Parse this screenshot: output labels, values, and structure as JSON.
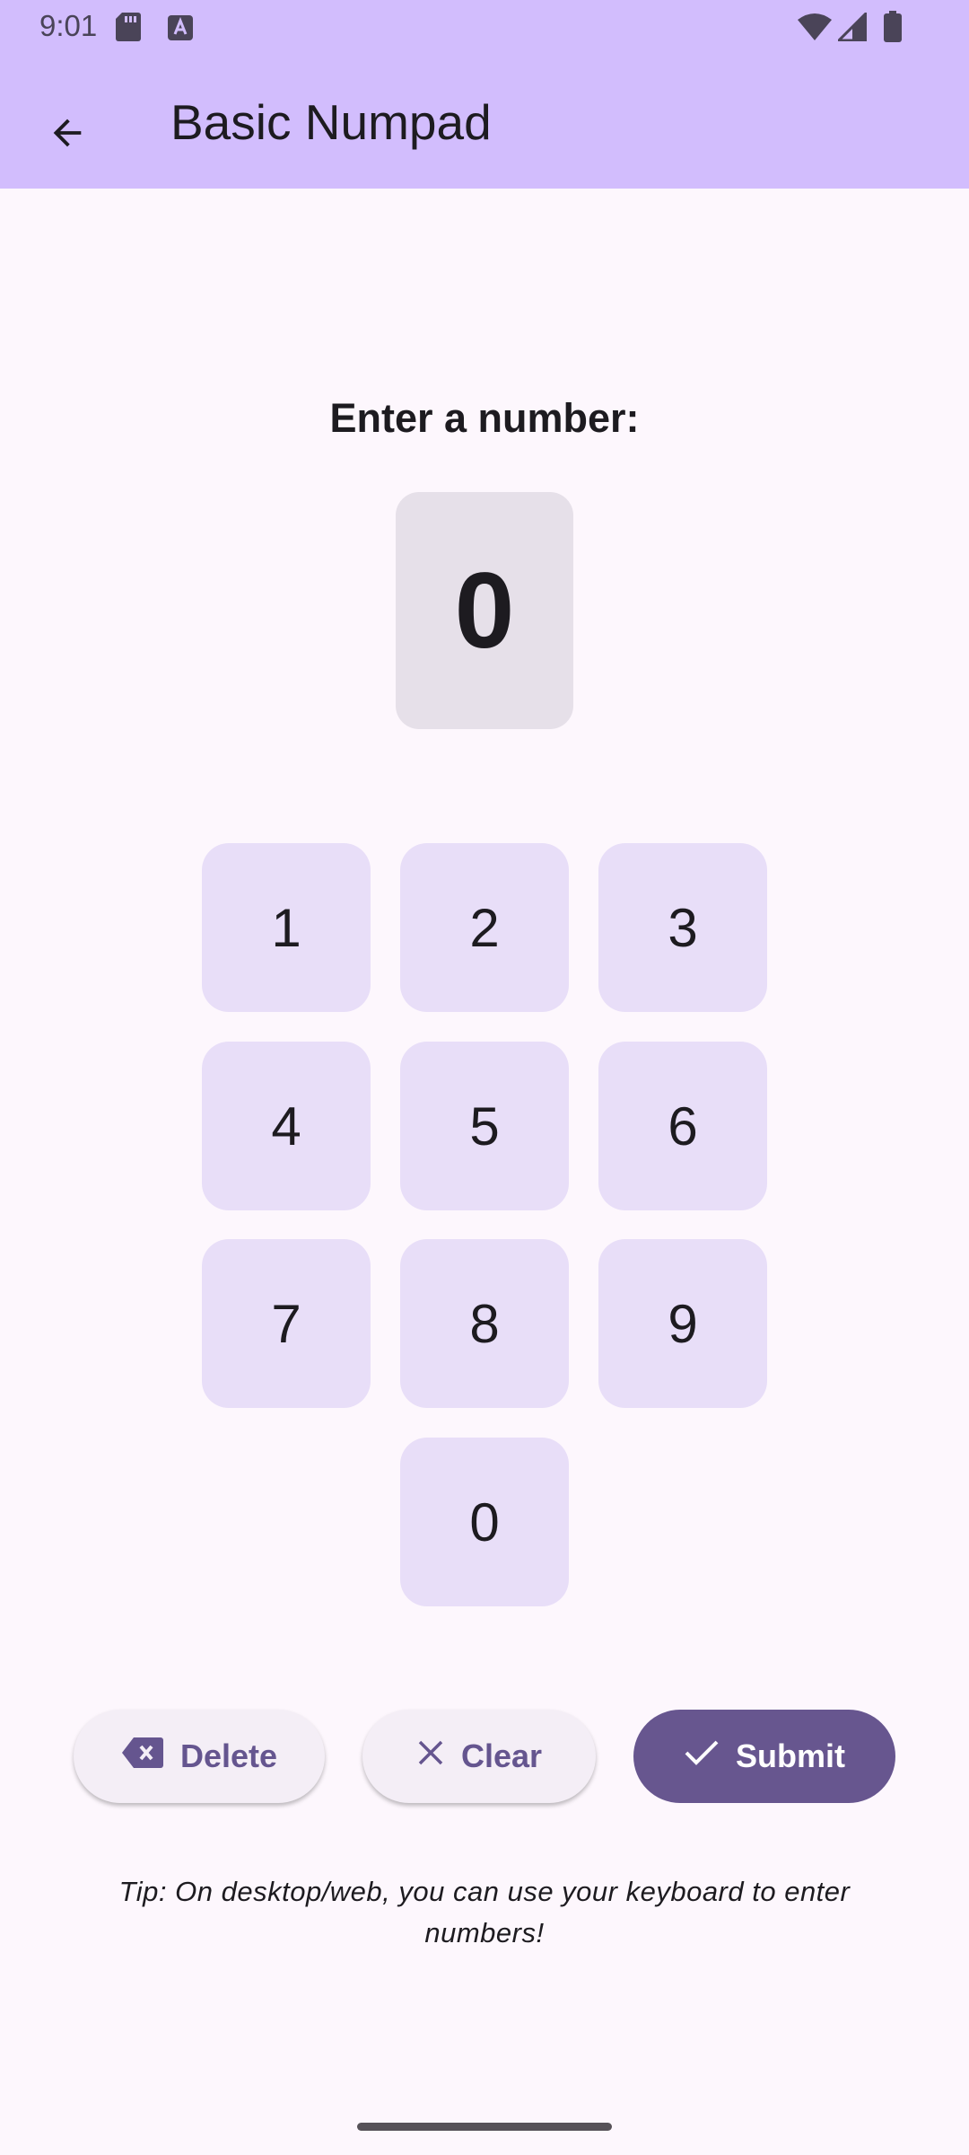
{
  "status_bar": {
    "time": "9:01",
    "icons": [
      "sd-card-icon",
      "keyboard-a-icon",
      "wifi-icon",
      "signal-icon",
      "battery-icon"
    ]
  },
  "app_bar": {
    "title": "Basic Numpad",
    "back_icon": "arrow-left-icon",
    "background": "#d2bdfd"
  },
  "main": {
    "prompt": "Enter a number:",
    "display_value": "0"
  },
  "keypad": {
    "keys": [
      "1",
      "2",
      "3",
      "4",
      "5",
      "6",
      "7",
      "8",
      "9",
      "0"
    ]
  },
  "actions": {
    "delete_label": "Delete",
    "clear_label": "Clear",
    "submit_label": "Submit"
  },
  "tip": "Tip: On desktop/web, you can use your keyboard to enter numbers!",
  "colors": {
    "primary": "#67568f",
    "key_background": "#e8def8",
    "display_background": "#e6e0e9"
  }
}
